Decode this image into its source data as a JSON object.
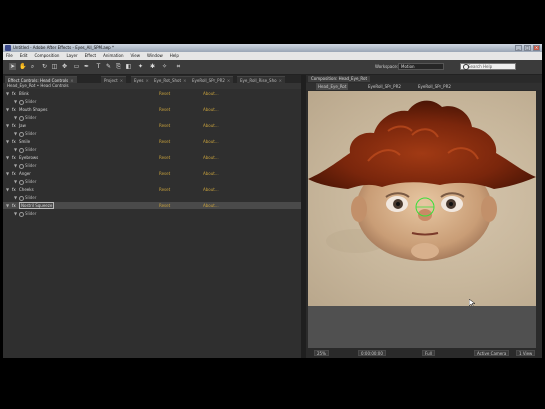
{
  "window": {
    "title": "Untitled - Adobe After Effects - Eyes_All_SPM.aep *"
  },
  "menu": [
    "File",
    "Edit",
    "Composition",
    "Layer",
    "Effect",
    "Animation",
    "View",
    "Window",
    "Help"
  ],
  "toolbar": {
    "workspace_label": "Workspace:",
    "workspace_value": "Motion",
    "search_placeholder": "Search Help"
  },
  "left_panel": {
    "tabs": [
      {
        "label": "Effect Controls: Head Controls",
        "active": true
      },
      {
        "label": "Project",
        "active": false
      },
      {
        "label": "Eyes",
        "active": false
      },
      {
        "label": "Eye_Rot_Shot",
        "active": false
      },
      {
        "label": "EyeRoll_SPr_PR2",
        "active": false
      },
      {
        "label": "Eye_Roll_Rise_Sho",
        "active": false
      }
    ],
    "path": "Head_Eye_Rot • Head Controls",
    "rows": [
      {
        "type": "effect",
        "name": "Blink",
        "reset": "Reset",
        "about": "About..."
      },
      {
        "type": "sub",
        "name": "Slider"
      },
      {
        "type": "effect",
        "name": "Mouth Shapes",
        "reset": "Reset",
        "about": "About..."
      },
      {
        "type": "sub",
        "name": "Slider"
      },
      {
        "type": "effect",
        "name": "Jaw",
        "reset": "Reset",
        "about": "About..."
      },
      {
        "type": "sub",
        "name": "Slider"
      },
      {
        "type": "effect",
        "name": "Smile",
        "reset": "Reset",
        "about": "About..."
      },
      {
        "type": "sub",
        "name": "Slider"
      },
      {
        "type": "effect",
        "name": "Eyebrows",
        "reset": "Reset",
        "about": "About..."
      },
      {
        "type": "sub",
        "name": "Slider"
      },
      {
        "type": "effect",
        "name": "Anger",
        "reset": "Reset",
        "about": "About..."
      },
      {
        "type": "sub",
        "name": "Slider"
      },
      {
        "type": "effect",
        "name": "Cheeks",
        "reset": "Reset",
        "about": "About..."
      },
      {
        "type": "sub",
        "name": "Slider"
      },
      {
        "type": "effect",
        "name": "Nostril Squeeze",
        "reset": "Reset",
        "about": "About...",
        "selected": true
      },
      {
        "type": "sub",
        "name": "Slider"
      }
    ]
  },
  "right_panel": {
    "tab": "Composition: Head_Eye_Rot",
    "subtabs": [
      {
        "label": "Head_Eye_Rot",
        "active": true
      },
      {
        "label": "EyeRoll_SPr_PR2",
        "active": false
      },
      {
        "label": "EyeRoll_SPr_PR2",
        "active": false
      }
    ],
    "status": {
      "zoom": "25%",
      "timecode": "0:00:00:00",
      "resolution": "Full",
      "camera": "Active Camera",
      "views": "1 View"
    }
  },
  "colors": {
    "accent": "#c9a23c",
    "panel_bg": "#2f2f2f",
    "viewer_bg": "#cbbba0"
  }
}
